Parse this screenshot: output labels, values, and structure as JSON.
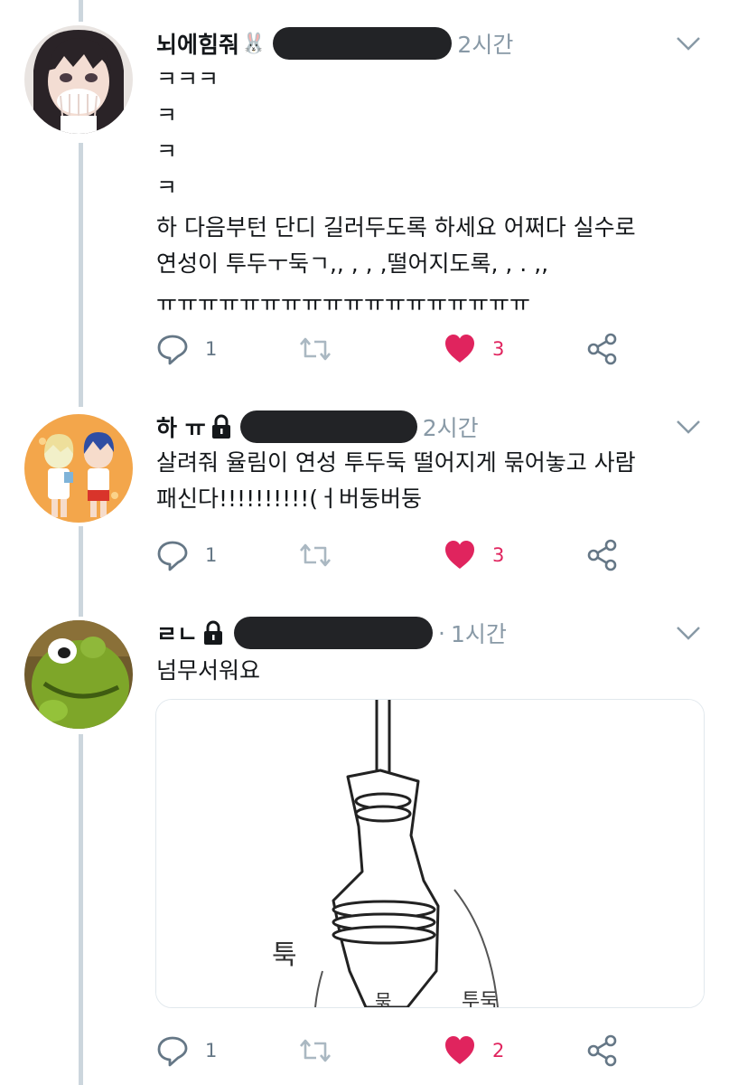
{
  "tweets": [
    {
      "name": "뇌에힘줘",
      "badge": "🐰",
      "time": "2시간",
      "lines": [
        "ㅋㅋㅋ",
        "ㅋ",
        "ㅋ",
        "ㅋ",
        "하 다음부턴 단디 길러두도록 하세요 어쩌다 실수로",
        "연성이 투두ㅜ둑ㄱ,, , , ,떨어지도록, , . ,,",
        "ㅠㅠㅠㅠㅠㅠㅠㅠㅠㅠㅠㅠㅠㅠㅠㅠㅠㅠ"
      ],
      "reply_count": "1",
      "like_count": "3"
    },
    {
      "name": "하 ㅠ",
      "time": "2시간",
      "lines": [
        "살려줘 율림이 연성 투두둑 떨어지게 묶어놓고 사람",
        "패신다!!!!!!!!!!(ㅓ버둥버둥"
      ],
      "reply_count": "1",
      "like_count": "3"
    },
    {
      "name": "ㄹㄴ",
      "time": "1시간",
      "lines": [
        "넘무서워요"
      ],
      "reply_count": "1",
      "like_count": "2",
      "media": {
        "text_tuk": "툭",
        "text_tudduk": "투둑",
        "text_muk": "묶"
      }
    }
  ],
  "colors": {
    "like": "#e0245e",
    "icon_gray": "#657786",
    "retweet_gray": "#aab8c2",
    "thread_line": "#ccd6dd",
    "redaction": "#222326"
  },
  "icons": {
    "reply": "reply-icon",
    "retweet": "retweet-icon",
    "like": "heart-icon",
    "share": "share-icon",
    "more": "chevron-down-icon",
    "protected": "lock-icon"
  }
}
